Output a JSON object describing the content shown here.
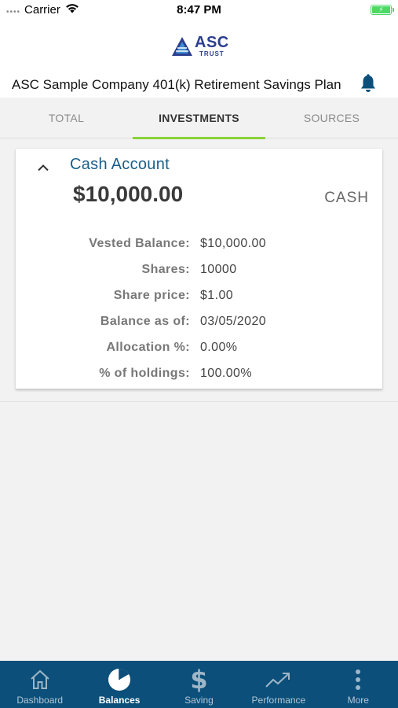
{
  "status_bar": {
    "carrier": "Carrier",
    "time": "8:47 PM",
    "signal_dots": "••••",
    "battery_icon": "battery-charging-icon"
  },
  "header": {
    "logo": {
      "text": "ASC",
      "subtext": "TRUST"
    },
    "plan_title": "ASC Sample Company 401(k) Retirement Savings Plan",
    "bell_icon": "bell-icon"
  },
  "tabs": [
    {
      "label": "TOTAL",
      "active": false
    },
    {
      "label": "INVESTMENTS",
      "active": true
    },
    {
      "label": "SOURCES",
      "active": false
    }
  ],
  "account_card": {
    "name": "Cash Account",
    "amount": "$10,000.00",
    "type": "CASH",
    "expanded": true,
    "rows": [
      {
        "label": "Vested Balance:",
        "value": "$10,000.00"
      },
      {
        "label": "Shares:",
        "value": "10000"
      },
      {
        "label": "Share price:",
        "value": "$1.00"
      },
      {
        "label": "Balance as of:",
        "value": "03/05/2020"
      },
      {
        "label": "Allocation %:",
        "value": "0.00%"
      },
      {
        "label": "% of holdings:",
        "value": "100.00%"
      }
    ]
  },
  "bottom_nav": [
    {
      "label": "Dashboard",
      "icon": "home-icon",
      "active": false
    },
    {
      "label": "Balances",
      "icon": "pie-chart-icon",
      "active": true
    },
    {
      "label": "Saving",
      "icon": "dollar-icon",
      "active": false
    },
    {
      "label": "Performance",
      "icon": "trend-up-icon",
      "active": false
    },
    {
      "label": "More",
      "icon": "more-vertical-icon",
      "active": false
    }
  ],
  "colors": {
    "accent_green": "#8bd33b",
    "nav_background": "#0b4f7a",
    "account_name": "#1b5f8a",
    "logo_blue": "#2b3f8f"
  }
}
